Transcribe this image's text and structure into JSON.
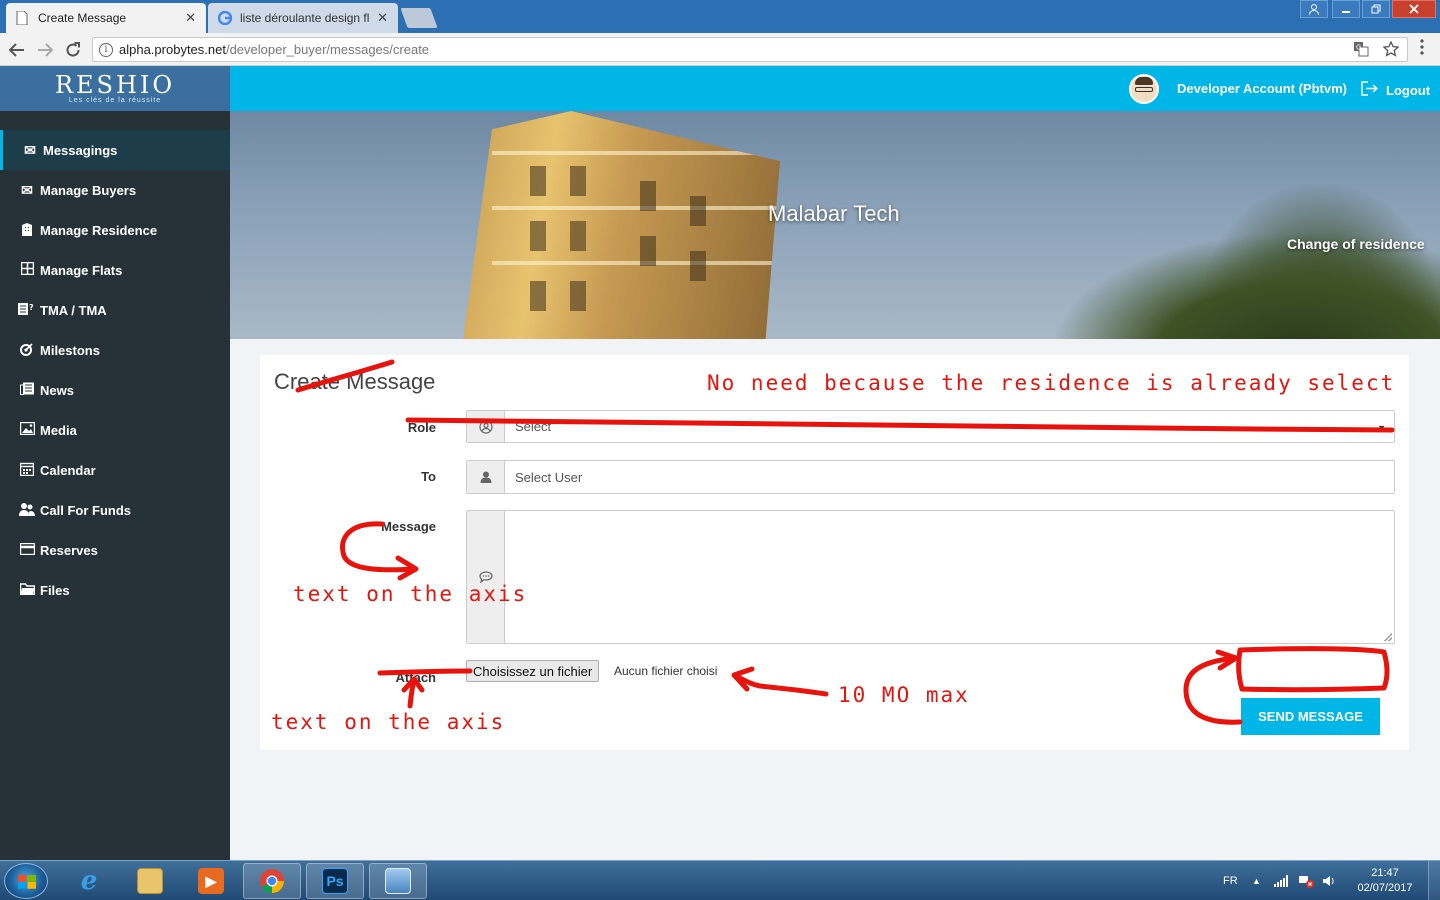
{
  "browser": {
    "tabs": [
      {
        "title": "Create Message",
        "active": true
      },
      {
        "title": "liste déroulante design fl",
        "active": false
      }
    ],
    "address": {
      "host": "alpha.probytes.net",
      "path": "/developer_buyer/messages/create"
    }
  },
  "app": {
    "logo_text": "RESHIO",
    "logo_tagline": "Les clés de la réussite",
    "account_name": "Developer Account (Pbtvm)",
    "logout_label": "Logout",
    "accent_color": "#00b6e6",
    "sidebar_color": "#263238"
  },
  "sidebar": {
    "items": [
      {
        "label": "Messagings",
        "icon": "envelope-icon",
        "active": true
      },
      {
        "label": "Manage Buyers",
        "icon": "envelope-icon"
      },
      {
        "label": "Manage Residence",
        "icon": "building-icon"
      },
      {
        "label": "Manage Flats",
        "icon": "grid-icon"
      },
      {
        "label": "TMA / TMA",
        "icon": "tma-icon"
      },
      {
        "label": "Milestons",
        "icon": "milestone-icon"
      },
      {
        "label": "News",
        "icon": "newspaper-icon"
      },
      {
        "label": "Media",
        "icon": "image-icon"
      },
      {
        "label": "Calendar",
        "icon": "calendar-icon"
      },
      {
        "label": "Call For Funds",
        "icon": "funds-icon"
      },
      {
        "label": "Reserves",
        "icon": "reserves-icon"
      },
      {
        "label": "Files",
        "icon": "folder-icon"
      }
    ]
  },
  "banner": {
    "residence_name": "Malabar Tech",
    "change_link": "Change of residence"
  },
  "form": {
    "title": "Create Message",
    "role": {
      "label": "Role",
      "placeholder": "Select"
    },
    "to": {
      "label": "To",
      "placeholder": "Select User"
    },
    "message": {
      "label": "Message",
      "value": ""
    },
    "attach": {
      "label": "Attach",
      "button": "Choisissez un fichier",
      "status": "Aucun fichier choisi"
    },
    "send_label": "SEND MESSAGE"
  },
  "annotations": {
    "note_residence": "No need because the residence is already select",
    "note_message_axis": "text on the axis",
    "note_attach_axis": "text on the axis",
    "note_file_size": "10 MO max",
    "color": "#e8130c"
  },
  "taskbar": {
    "language": "FR",
    "time": "21:47",
    "date": "02/07/2017"
  }
}
